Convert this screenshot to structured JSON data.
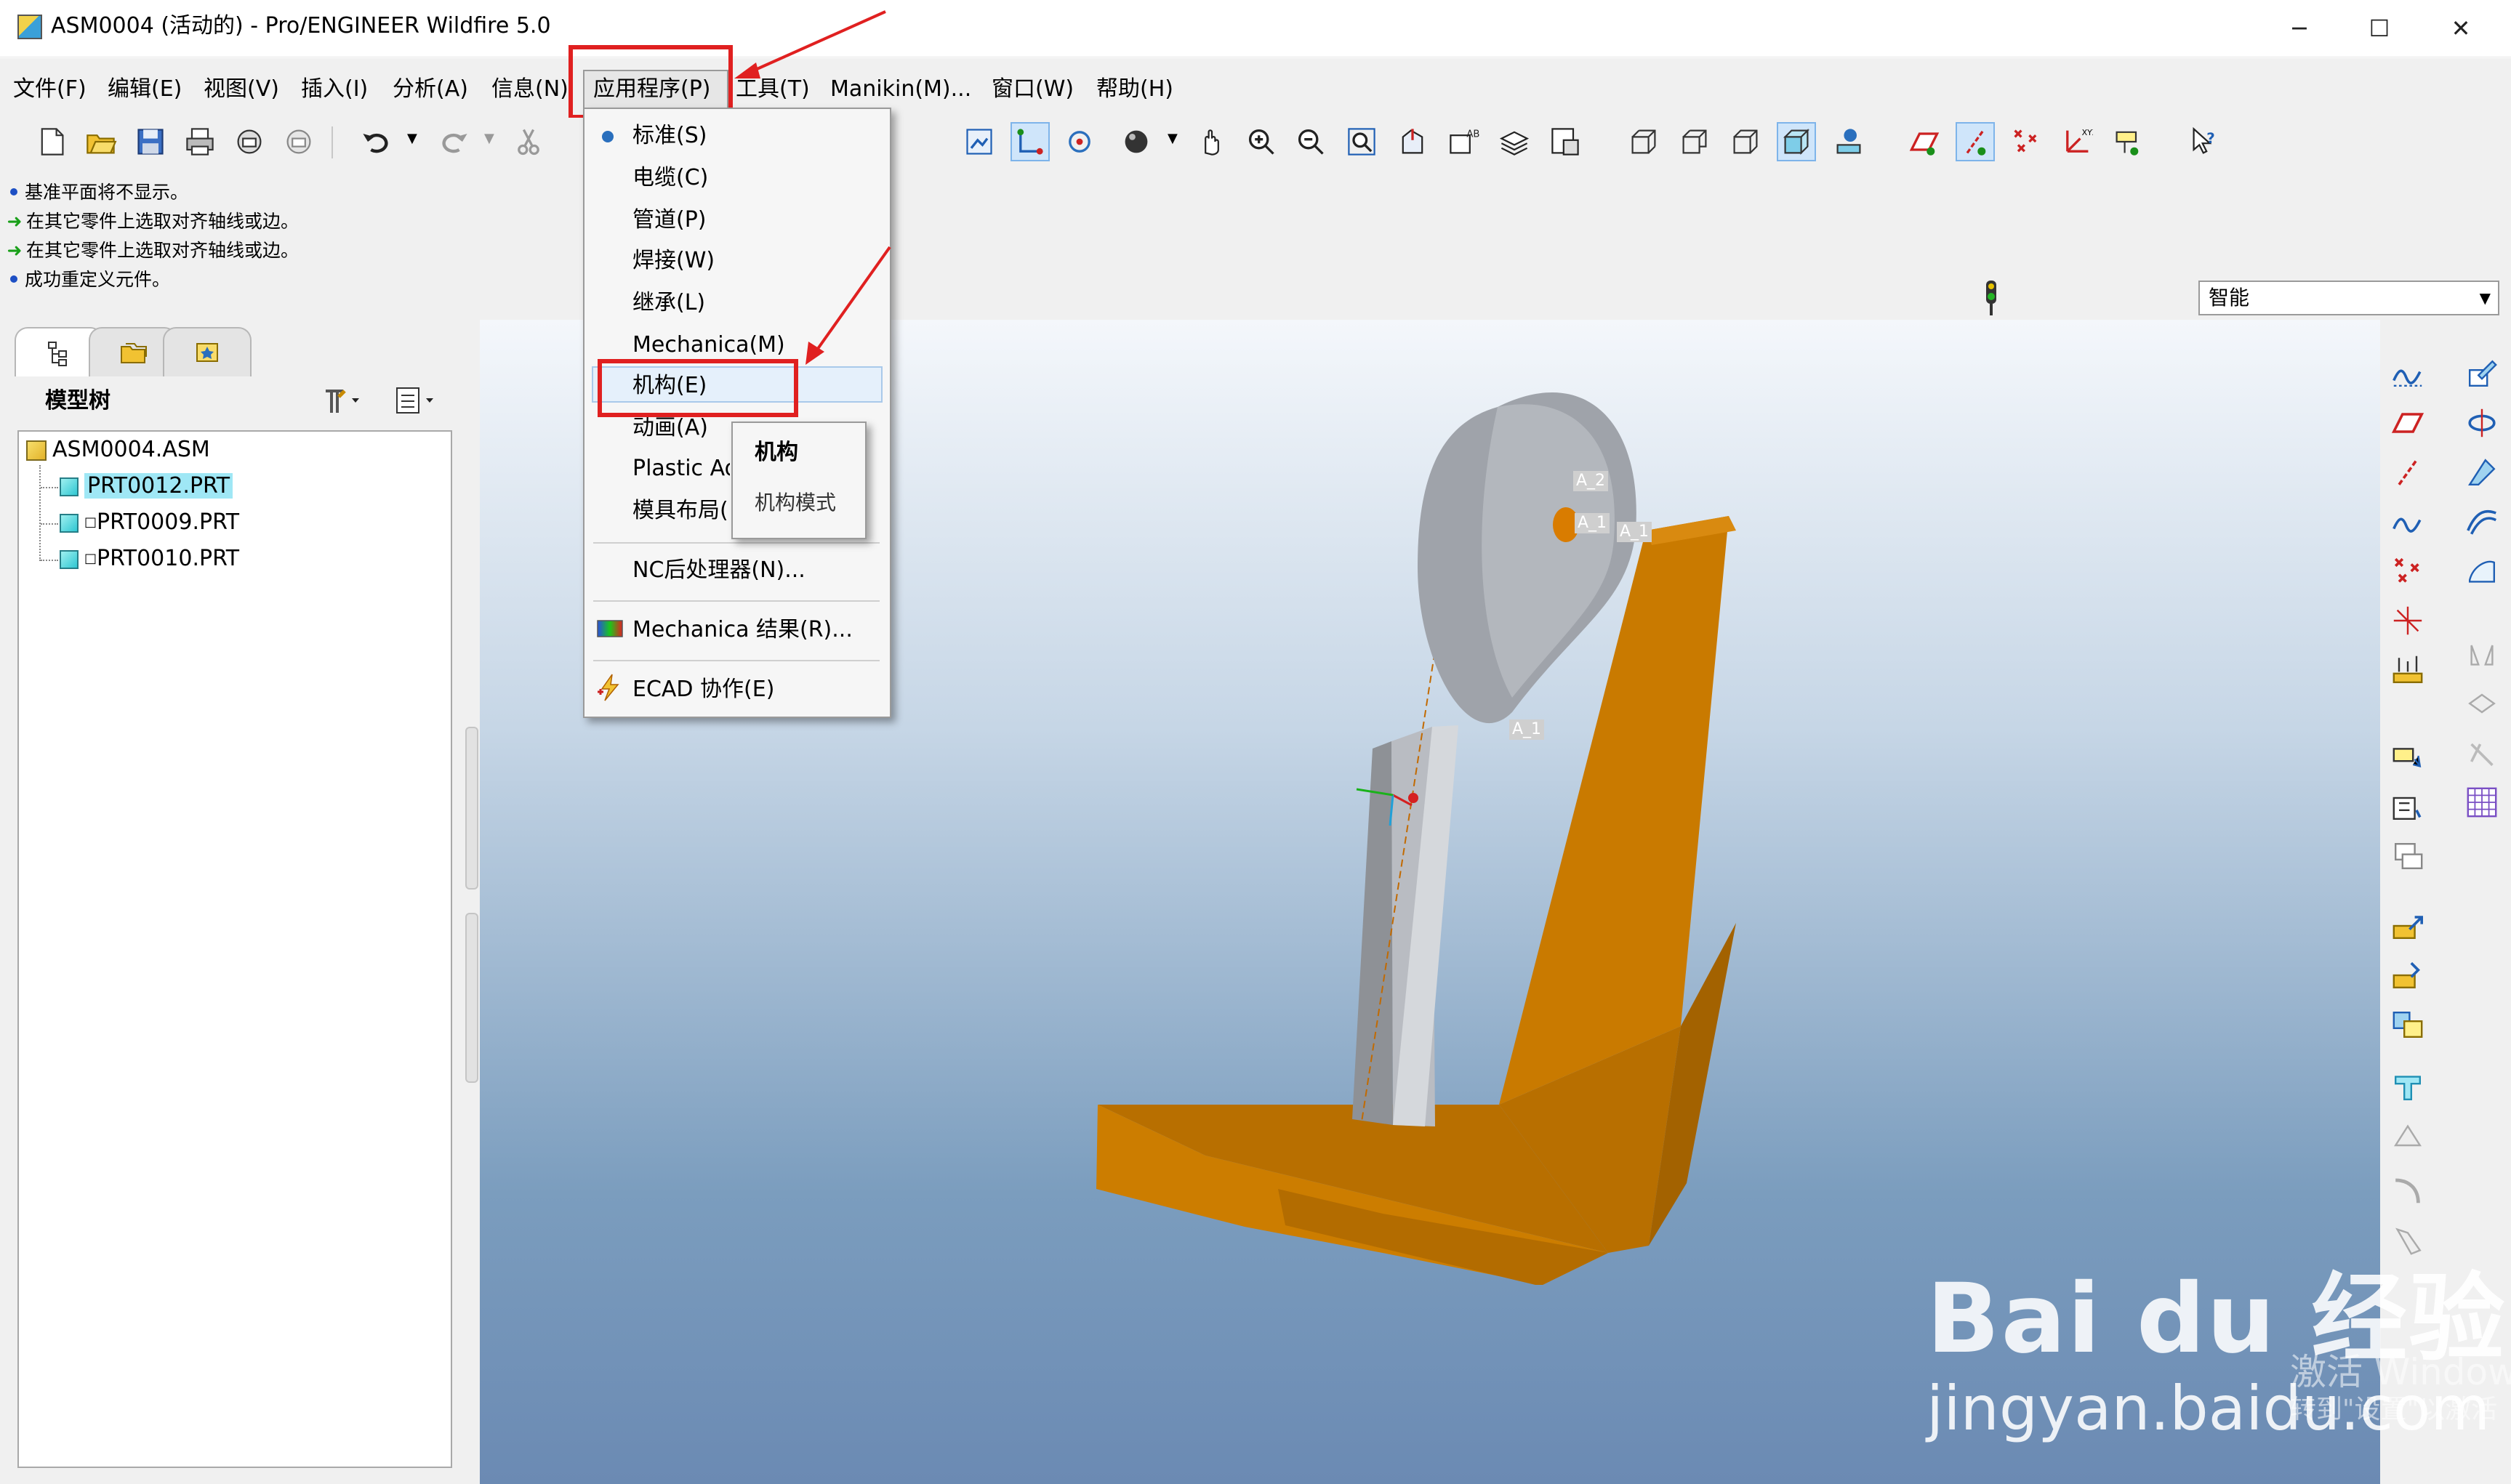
{
  "window": {
    "title": "ASM0004 (活动的) - Pro/ENGINEER Wildfire 5.0",
    "minimize_label": "─",
    "maximize_label": "☐",
    "close_label": "✕"
  },
  "menubar": {
    "items": [
      {
        "label": "文件(F)"
      },
      {
        "label": "编辑(E)"
      },
      {
        "label": "视图(V)"
      },
      {
        "label": "插入(I)"
      },
      {
        "label": "分析(A)"
      },
      {
        "label": "信息(N)"
      },
      {
        "label": "应用程序(P)"
      },
      {
        "label": "工具(T)"
      },
      {
        "label": "Manikin(M)..."
      },
      {
        "label": "窗口(W)"
      },
      {
        "label": "帮助(H)"
      }
    ]
  },
  "messages": [
    {
      "text": "基准平面将不显示。",
      "icon": "bullet"
    },
    {
      "text": "在其它零件上选取对齐轴线或边。",
      "icon": "green-arrow"
    },
    {
      "text": "在其它零件上选取对齐轴线或边。",
      "icon": "green-arrow"
    },
    {
      "text": "成功重定义元件。",
      "icon": "bullet"
    }
  ],
  "filter": {
    "value": "智能",
    "arrow": "▼"
  },
  "model_tree": {
    "header": "模型树",
    "root": "ASM0004.ASM",
    "parts": [
      {
        "name": "PRT0012.PRT",
        "selected": true
      },
      {
        "name": "PRT0009.PRT",
        "selected": false
      },
      {
        "name": "PRT0010.PRT",
        "selected": false
      }
    ]
  },
  "app_menu": {
    "items": [
      {
        "label": "标准(S)",
        "checked": true
      },
      {
        "label": "电缆(C)"
      },
      {
        "label": "管道(P)"
      },
      {
        "label": "焊接(W)"
      },
      {
        "label": "继承(L)"
      },
      {
        "label": "Mechanica(M)"
      },
      {
        "label": "机构(E)",
        "highlighted": true
      },
      {
        "label": "动画(A)"
      },
      {
        "label": "Plastic Ad"
      },
      {
        "label": "模具布局(I"
      },
      {
        "label": "NC后处理器(N)..."
      },
      {
        "label": "Mechanica 结果(R)..."
      },
      {
        "label": "ECAD 协作(E)"
      }
    ]
  },
  "tooltip": {
    "title": "机构",
    "desc": "机构模式"
  },
  "model_labels": [
    "A_2",
    "A_1",
    "A_1",
    "A_1"
  ],
  "colors": {
    "accent_red": "#e02020",
    "part_orange": "#c97a00",
    "viewport_top": "#f4f7fb",
    "viewport_bottom": "#6b8ab3",
    "selection": "#9fe7f5"
  },
  "watermark": {
    "logo": "Bai du 经验",
    "url": "jingyan.baidu.com",
    "activate_1": "激活 Window",
    "activate_2": "转到\"设置\"以激活"
  }
}
